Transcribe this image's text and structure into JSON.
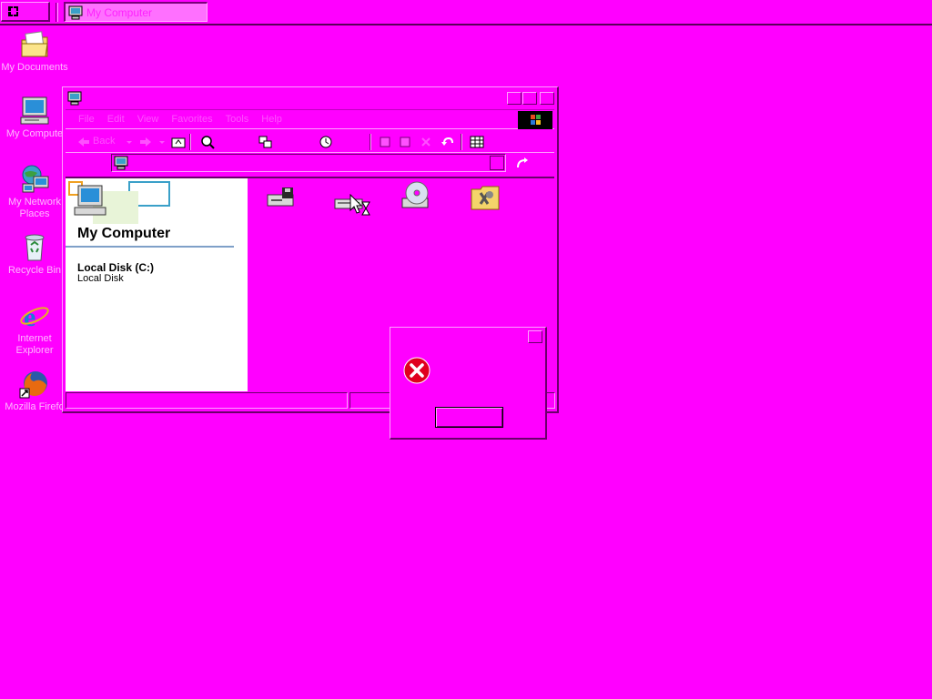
{
  "taskbar": {
    "start_label": "",
    "tasks": [
      {
        "label": "My Computer",
        "active": true
      }
    ]
  },
  "desktop": {
    "icons": [
      {
        "label": "My Documents",
        "icon": "my-documents-icon"
      },
      {
        "label": "My Compute",
        "icon": "my-computer-icon"
      },
      {
        "label": "My Network Places",
        "icon": "network-places-icon"
      },
      {
        "label": "Recycle Bin",
        "icon": "recycle-bin-icon"
      },
      {
        "label": "Internet Explorer",
        "icon": "internet-explorer-icon"
      },
      {
        "label": "Mozilla Firefo",
        "icon": "firefox-icon"
      }
    ]
  },
  "explorer": {
    "title": "",
    "menu": [
      "File",
      "Edit",
      "View",
      "Favorites",
      "Tools",
      "Help"
    ],
    "toolbar": {
      "back_label": "Back"
    },
    "address": {
      "value": ""
    },
    "left_pane": {
      "title": "My Computer",
      "item_name": "Local Disk (C:)",
      "item_desc": "Local Disk"
    },
    "drives": [
      "floppy-drive-icon",
      "hard-disk-icon",
      "cd-drive-icon",
      "control-panel-folder-icon"
    ]
  },
  "dialog": {
    "icon": "error-icon",
    "ok_label": ""
  },
  "colors": {
    "desktop": "#ff00ff",
    "error_red": "#e0001e",
    "pane_bg": "#ffffff"
  }
}
